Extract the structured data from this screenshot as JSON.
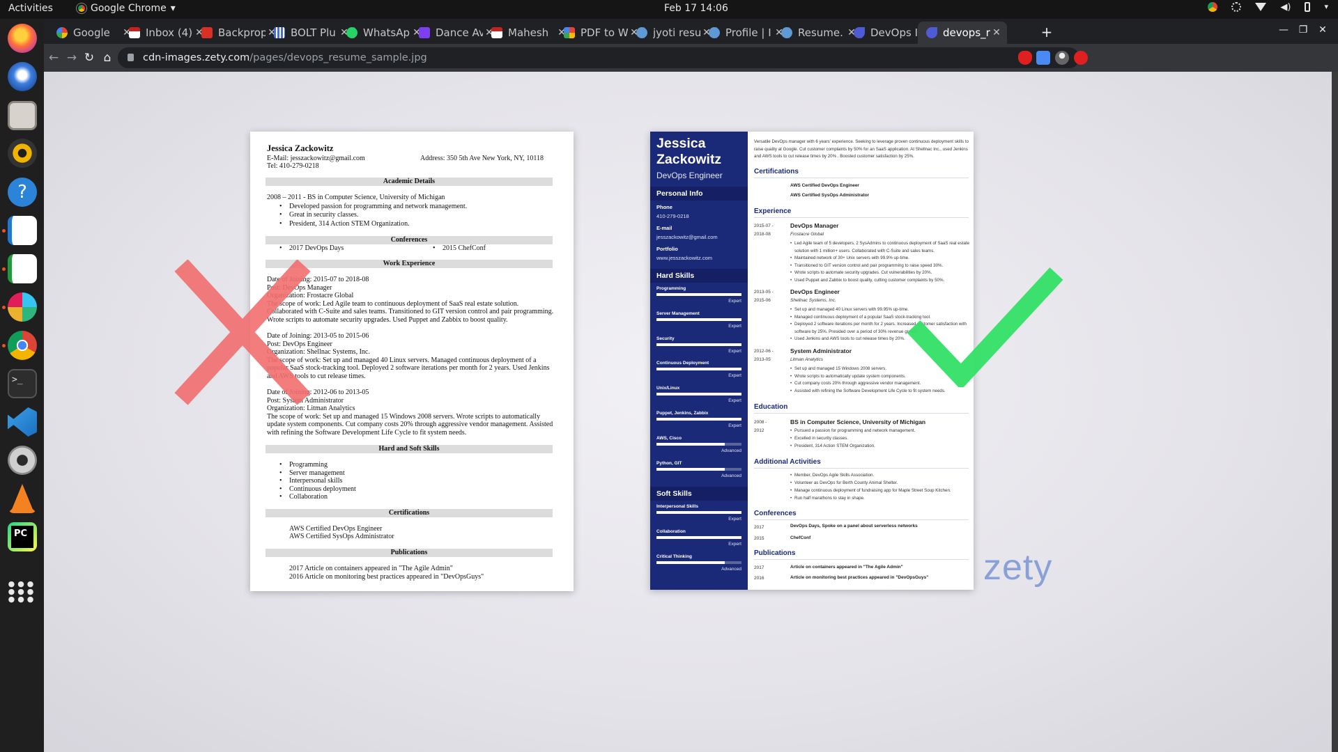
{
  "topbar": {
    "activities": "Activities",
    "app_name": "Google Chrome",
    "clock": "Feb 17  14:06"
  },
  "tabs": [
    {
      "label": "Google",
      "color": "#ea4335"
    },
    {
      "label": "Inbox (4)",
      "color": "#c5221f"
    },
    {
      "label": "Backprop",
      "color": "#d93025"
    },
    {
      "label": "BOLT Plu",
      "color": "#4a6fd1"
    },
    {
      "label": "WhatsAp",
      "color": "#25d366"
    },
    {
      "label": "Dance Av",
      "color": "#7e3ff2"
    },
    {
      "label": "Mahesh",
      "color": "#c5221f"
    },
    {
      "label": "PDF to W",
      "color": "#f4b400"
    },
    {
      "label": "jyoti resu",
      "color": "#5f9ad6"
    },
    {
      "label": "Profile | I",
      "color": "#5f9ad6"
    },
    {
      "label": "Resume.",
      "color": "#5f9ad6"
    },
    {
      "label": "DevOps I",
      "color": "#4f5bd5"
    },
    {
      "label": "devops_r",
      "color": "#4f5bd5"
    }
  ],
  "omnibox": {
    "host": "cdn-images.zety.com",
    "path": "/pages/devops_resume_sample.jpg"
  },
  "left_resume": {
    "name": "Jessica Zackowitz",
    "email": "E-Mail: jesszackowitz@gmail.com",
    "address": "Address: 350 5th Ave New York, NY, 10118",
    "tel": "Tel: 410-279-0218",
    "academic_head": "Academic Details",
    "degree": "2008 – 2011 - BS in Computer Science, University of Michigan",
    "academic_bullets": [
      "Developed passion for programming and network management.",
      "Great in security classes.",
      "President, 314 Action STEM Organization."
    ],
    "conf_head": "Conferences",
    "conf1": "2017 DevOps Days",
    "conf2": "2015 ChefConf",
    "work_head": "Work Experience",
    "job1": "Date of Joining: 2015-07 to 2018-08\nPost: DevOps Manager\nOrganization: Frostacre Global\nThe scope of work: Led Agile team to continuous deployment of SaaS real estate solution. Collaborated with C-Suite and sales teams. Transitioned to GIT version control and pair programming. Wrote scripts to automate security upgrades. Used Puppet and Zabbix to boost quality.",
    "job2": "Date of Joining: 2013-05 to 2015-06\nPost: DevOps Engineer\nOrganization: Shellnac Systems, Inc.\nThe scope of work: Set up and managed 40 Linux servers. Managed continuous deployment of a popular SaaS stock-tracking tool. Deployed 2 software iterations per month for 2 years. Used Jenkins and AWS tools to cut release times.",
    "job3": "Date of Joining: 2012-06 to 2013-05\nPost: System Administrator\nOrganization: Litman Analytics\nThe scope of work: Set up and managed 15 Windows 2008 servers. Wrote scripts to automatically update system components. Cut company costs 20% through aggressive vendor management. Assisted with refining the Software Development Life Cycle to fit system needs.",
    "skills_head": "Hard and Soft Skills",
    "skills": [
      "Programming",
      "Server management",
      "Interpersonal skills",
      "Continuous deployment",
      "Collaboration"
    ],
    "cert_head": "Certifications",
    "certs": [
      "AWS Certified DevOps Engineer",
      "AWS Certified SysOps Administrator"
    ],
    "pub_head": "Publications",
    "pub1": "2017 Article on containers appeared in \"The Agile Admin\"",
    "pub2": "2016 Article on monitoring best practices appeared in \"DevOpsGuys\""
  },
  "right_resume": {
    "first_name": "Jessica",
    "last_name": "Zackowitz",
    "title": "DevOps Engineer",
    "personal_head": "Personal Info",
    "phone_label": "Phone",
    "phone": "410-279-0218",
    "email_label": "E-mail",
    "email": "jesszackowitz@gmail.com",
    "portfolio_label": "Portfolio",
    "portfolio": "www.jesszackowitz.com",
    "hard_head": "Hard Skills",
    "hard_skills": [
      {
        "name": "Programming",
        "level": "Expert",
        "value": 1.0
      },
      {
        "name": "Server Management",
        "level": "Expert",
        "value": 1.0
      },
      {
        "name": "Security",
        "level": "Expert",
        "value": 1.0
      },
      {
        "name": "Continuous Deployment",
        "level": "Expert",
        "value": 1.0
      },
      {
        "name": "Unix/Linux",
        "level": "Expert",
        "value": 1.0
      },
      {
        "name": "Puppet, Jenkins, Zabbix",
        "level": "Expert",
        "value": 1.0
      },
      {
        "name": "AWS, Cisco",
        "level": "Advanced",
        "value": 0.8
      },
      {
        "name": "Python, GIT",
        "level": "Advanced",
        "value": 0.8
      }
    ],
    "soft_head": "Soft Skills",
    "soft_skills": [
      {
        "name": "Interpersonal Skills",
        "level": "Expert",
        "value": 1.0
      },
      {
        "name": "Collaboration",
        "level": "Expert",
        "value": 1.0
      },
      {
        "name": "Critical Thinking",
        "level": "Advanced",
        "value": 0.8
      }
    ],
    "summary": "Versatile DevOps manager with 6 years' experience. Seeking to leverage proven continuous deployment skills to raise quality at Google. Cut customer complaints by 50% for an SaaS application. At Shellnac Inc., used Jenkins and AWS tools to cut release times by 20% . Boosted customer satisfaction by 25%.",
    "cert_head": "Certifications",
    "certs": [
      "AWS Certified DevOps Engineer",
      "AWS Certified SysOps Administrator"
    ],
    "exp_head": "Experience",
    "jobs": [
      {
        "date": "2015-07 -\n2018-08",
        "title": "DevOps Manager",
        "org": "Frostacre Global",
        "bullets": [
          "Led Agile team of 5 developers, 2 SysAdmins to continuous deployment of SaaS real estate solution with 1 million+ users. Collaborated with C-Suite and sales teams.",
          "Maintained network of 30+ Unix servers with 99.9% up-time.",
          "Transitioned to GIT version control and pair programming to raise speed 30%.",
          "Wrote scripts to automate security upgrades. Cut vulnerabilities by 20%.",
          "Used Puppet and Zabbix to boost quality, cutting customer complaints by 50%."
        ]
      },
      {
        "date": "2013-05 -\n2015-06",
        "title": "DevOps Engineer",
        "org": "Shellnac Systems, Inc.",
        "bullets": [
          "Set up and managed 40 Linux servers with 99.95% up-time.",
          "Managed continuous deployment of a popular SaaS stock-tracking tool.",
          "Deployed 2 software iterations per month for 2 years. Increased customer satisfaction with software by 25%. Presided over a period of 30% revenue growth.",
          "Used Jenkins and AWS tools to cut release times by 20%."
        ]
      },
      {
        "date": "2012-06 -\n2013-05",
        "title": "System Administrator",
        "org": "Litman Analytics",
        "bullets": [
          "Set up and managed 15 Windows 2008 servers.",
          "Wrote scripts to automatically update system components.",
          "Cut company costs 20% through aggressive vendor management.",
          "Assisted with refining the Software Development Life Cycle to fit system needs."
        ]
      }
    ],
    "edu_head": "Education",
    "edu": {
      "date": "2008 -\n2012",
      "degree": "BS in Computer Science, University of Michigan",
      "bullets": [
        "Pursued a passion for programming and network management.",
        "Excelled in security classes.",
        "President, 314 Action STEM Organization."
      ]
    },
    "act_head": "Additional Activities",
    "activities": [
      "Member, DevOps Agile Skills Association.",
      "Volunteer as DevOps for Berth County Animal Shelter.",
      "Manage continuous deployment of fundraising app for Maple Street Soup Kitchen.",
      "Run half marathons to stay in shape."
    ],
    "conf_head": "Conferences",
    "confs": [
      {
        "year": "2017",
        "text": "DevOps Days, Spoke on a panel about serverless networks"
      },
      {
        "year": "2015",
        "text": "ChefConf"
      }
    ],
    "pub_head": "Publications",
    "pubs": [
      {
        "year": "2017",
        "text": "Article on containers appeared in \"The Agile Admin\""
      },
      {
        "year": "2016",
        "text": "Article on monitoring best practices appeared in \"DevOpsGuys\""
      }
    ]
  },
  "watermark": "zety",
  "colors": {
    "bad_mark": "#f26f6f",
    "good_mark": "#33e066",
    "sidebar": "#1b2a78"
  }
}
